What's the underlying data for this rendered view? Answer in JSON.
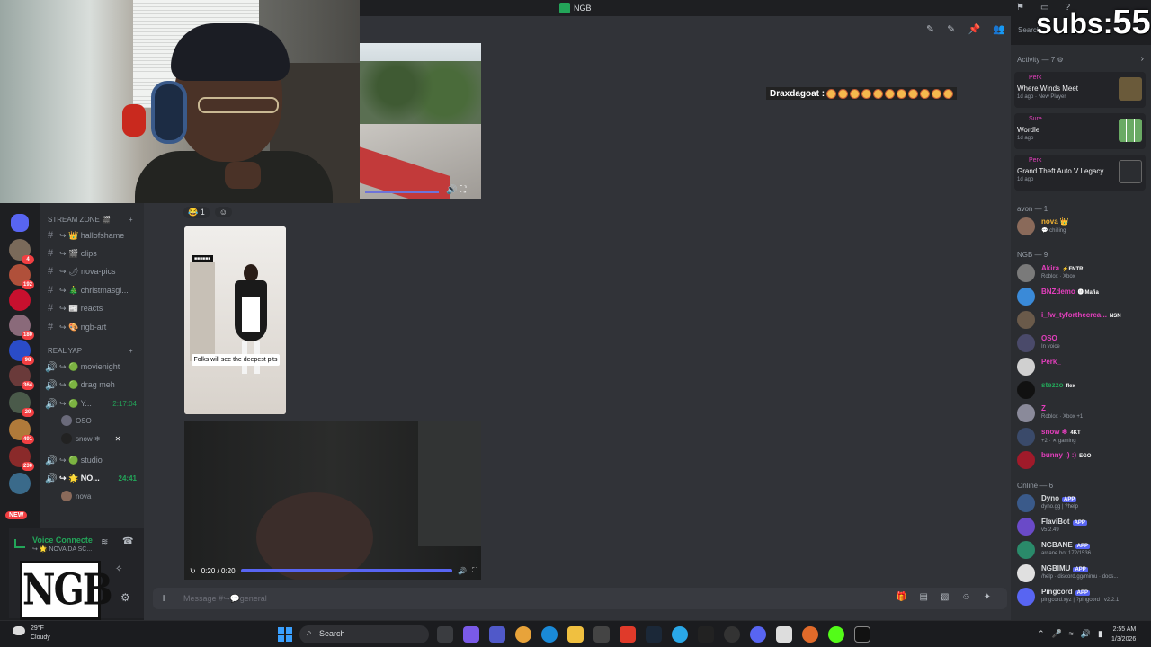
{
  "window": {
    "title": "NGB"
  },
  "overlay": {
    "subs_label": "subs:",
    "subs_count": "55"
  },
  "search": {
    "placeholder": "Search"
  },
  "server_rail": {
    "badges": [
      "4",
      "192",
      "180",
      "98",
      "364",
      "29",
      "491",
      "230"
    ],
    "new_label": "NEW"
  },
  "channels": {
    "category1": "STREAM ZONE 🎬",
    "stream_zone": [
      {
        "label": "↪ 👑 hallofshame"
      },
      {
        "label": "↪ 🎬 clips"
      },
      {
        "label": "↪ 🌶 nova-pics"
      },
      {
        "label": "↪ 🎄 christmasgi..."
      },
      {
        "label": "↪ 📰 reacts"
      },
      {
        "label": "↪ 🎨 ngb-art"
      }
    ],
    "category2": "REAL YAP",
    "real_yap": [
      {
        "label": "↪ 🟢 movienight",
        "time": ""
      },
      {
        "label": "↪ 🟢 drag meh",
        "time": ""
      },
      {
        "label": "↪ 🟢 Y...",
        "time": "2:17:04"
      }
    ],
    "vc1_users": [
      {
        "name": "OSO"
      },
      {
        "name": "snow ❄"
      }
    ],
    "more": [
      {
        "label": "↪ 🟢 studio",
        "time": ""
      },
      {
        "label": "↪ 🌟 NO...",
        "time": "24:41"
      }
    ],
    "vc2_users": [
      {
        "name": "nova"
      }
    ]
  },
  "voice": {
    "status": "Voice Connecte",
    "channel": "↪ 🌟 NOVA DA SC..."
  },
  "logo_text": "NGB",
  "reaction": {
    "count": "1"
  },
  "image_caption": "Folks will see the deepest pits",
  "video2": {
    "time": "0:20 / 0:20"
  },
  "emoji_strip": {
    "user": "Draxdagoat :"
  },
  "composer": {
    "placeholder": "Message #↪💬general"
  },
  "members": {
    "activity_header": "Activity — 7",
    "activities": [
      {
        "user": "Perk",
        "game": "Where Winds Meet",
        "time": "1d ago",
        "extra": "New Player"
      },
      {
        "user": "Sure",
        "game": "Wordle",
        "time": "1d ago",
        "extra": ""
      },
      {
        "user": "Perk",
        "game": "Grand Theft Auto V Legacy",
        "time": "1d ago",
        "extra": ""
      }
    ],
    "avon_header": "avon — 1",
    "avon": [
      {
        "name": "nova 👑",
        "status": "💬 chilling",
        "color": "#f0b232"
      }
    ],
    "ngb_header": "NGB — 9",
    "ngb": [
      {
        "name": "Akira",
        "tag": "⚡FNTR",
        "status": "Roblox · Xbox",
        "color": "#e43fbd"
      },
      {
        "name": "BNZdemo",
        "tag": "🅜 Mafia",
        "status": "",
        "color": "#e43fbd"
      },
      {
        "name": "i_fw_tyforthecrea...",
        "tag": "NSN",
        "status": "",
        "color": "#e43fbd"
      },
      {
        "name": "OSO",
        "tag": "",
        "status": "In voice",
        "color": "#e43fbd"
      },
      {
        "name": "Perk_",
        "tag": "",
        "status": "",
        "color": "#e43fbd"
      },
      {
        "name": "stezzo",
        "tag": "flex",
        "status": "",
        "color": "#23a559"
      },
      {
        "name": "Z",
        "tag": "",
        "status": "Roblox · Xbox +1",
        "color": "#e43fbd"
      },
      {
        "name": "snow ❄",
        "tag": "4KT",
        "status": "+2 · ✕ gaming",
        "color": "#e43fbd"
      },
      {
        "name": "bunny :) :)",
        "tag": "EGO",
        "status": "",
        "color": "#e43fbd"
      }
    ],
    "online_header": "Online — 6",
    "online": [
      {
        "name": "Dyno",
        "app": "APP",
        "status": "dyno.gg | ?help"
      },
      {
        "name": "FlaviBot",
        "app": "APP",
        "status": "v5.2.49"
      },
      {
        "name": "NGBANE",
        "app": "APP",
        "status": "arcane.bot 172/1536"
      },
      {
        "name": "NGBIMU",
        "app": "APP",
        "status": "/help · discord.gg/mimu · docs..."
      },
      {
        "name": "Pingcord",
        "app": "APP",
        "status": "pingcord.xyz | ?pingcord | v2.2.1"
      }
    ]
  },
  "taskbar": {
    "weather_temp": "29°F",
    "weather_desc": "Cloudy",
    "search_label": "Search",
    "time": "2:55 AM",
    "date": "1/3/2026"
  },
  "colors": {
    "accent": "#5865f2",
    "online": "#23a559",
    "pink_role": "#e43fbd",
    "danger": "#f23f42"
  }
}
